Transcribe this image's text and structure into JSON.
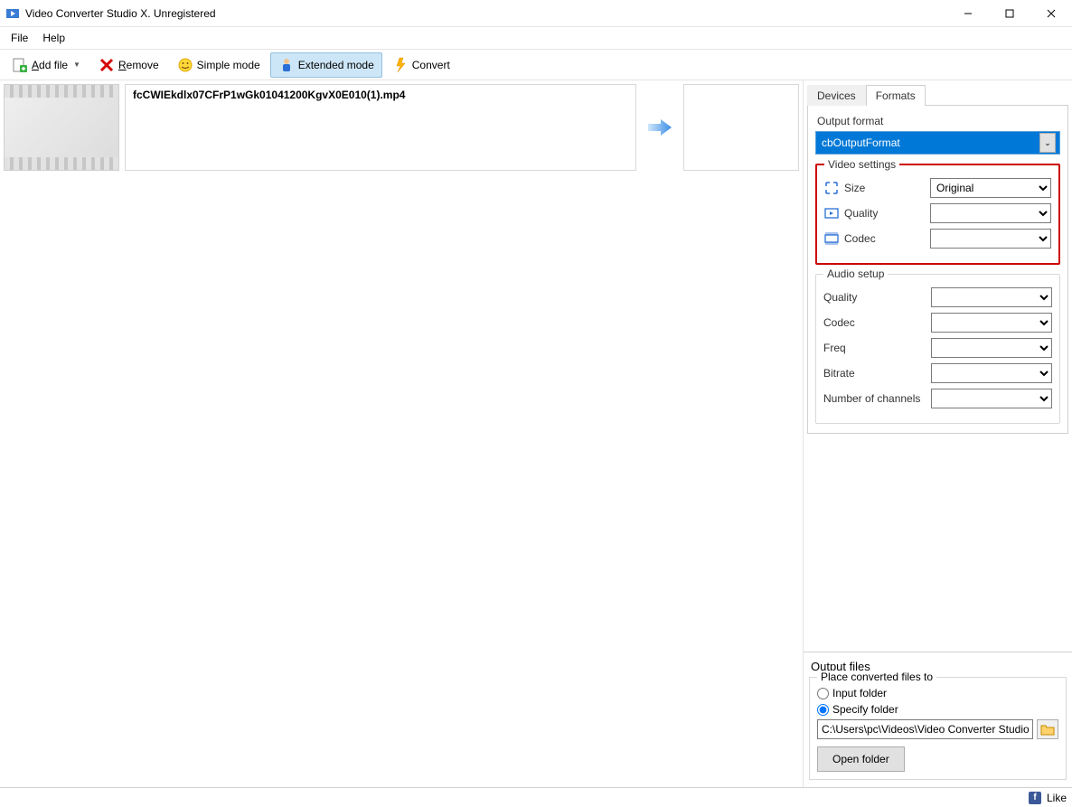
{
  "window": {
    "title": "Video Converter Studio X. Unregistered"
  },
  "menu": {
    "file": "File",
    "help": "Help"
  },
  "toolbar": {
    "add_file": "Add file",
    "remove": "Remove",
    "simple_mode": "Simple mode",
    "extended_mode": "Extended mode",
    "convert": "Convert"
  },
  "file": {
    "name": "fcCWIEkdlx07CFrP1wGk01041200KgvX0E010(1).mp4"
  },
  "tabs": {
    "devices": "Devices",
    "formats": "Formats"
  },
  "format_panel": {
    "output_format_label": "Output format",
    "output_format_value": "cbOutputFormat",
    "video_settings_legend": "Video settings",
    "video": {
      "size_label": "Size",
      "size_value": "Original",
      "quality_label": "Quality",
      "quality_value": "",
      "codec_label": "Codec",
      "codec_value": ""
    },
    "audio_legend": "Audio setup",
    "audio": {
      "quality_label": "Quality",
      "quality_value": "",
      "codec_label": "Codec",
      "codec_value": "",
      "freq_label": "Freq",
      "freq_value": "",
      "bitrate_label": "Bitrate",
      "bitrate_value": "",
      "channels_label": "Number of channels",
      "channels_value": ""
    }
  },
  "output": {
    "section_title": "Output files",
    "place_legend": "Place converted files to",
    "input_folder": "Input folder",
    "specify_folder": "Specify folder",
    "path": "C:\\Users\\pc\\Videos\\Video Converter Studio\\",
    "open_folder": "Open folder"
  },
  "status": {
    "like": "Like"
  }
}
